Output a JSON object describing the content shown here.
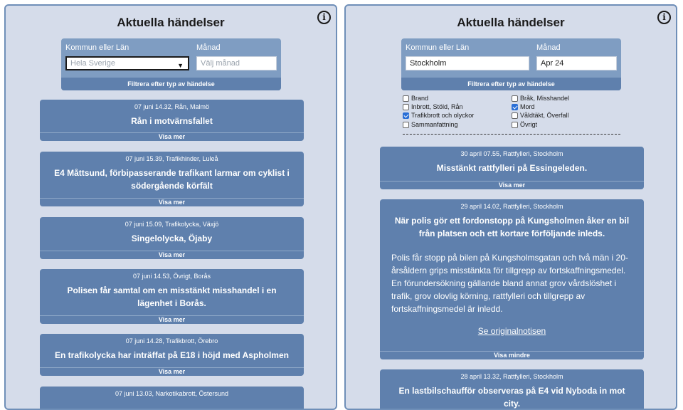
{
  "left": {
    "title": "Aktuella händelser",
    "filter": {
      "region_label": "Kommun eller Län",
      "region_placeholder": "Hela Sverige",
      "month_label": "Månad",
      "month_placeholder": "Välj månad",
      "type_button": "Filtrera efter typ av händelse"
    },
    "events": [
      {
        "meta": "07 juni 14.32, Rån, Malmö",
        "headline": "Rån i motvärnsfallet",
        "more": "Visa mer"
      },
      {
        "meta": "07 juni 15.39, Trafikhinder, Luleå",
        "headline": "E4 Måttsund, förbipasserande trafikant larmar om cyklist i södergående körfält",
        "more": "Visa mer"
      },
      {
        "meta": "07 juni 15.09, Trafikolycka, Växjö",
        "headline": "Singelolycka, Öjaby",
        "more": "Visa mer"
      },
      {
        "meta": "07 juni 14.53, Övrigt, Borås",
        "headline": "Polisen får samtal om en misstänkt misshandel i en lägenhet i Borås.",
        "more": "Visa mer"
      },
      {
        "meta": "07 juni 14.28, Trafikbrott, Örebro",
        "headline": "En trafikolycka har inträffat på E18 i höjd med Aspholmen",
        "more": "Visa mer"
      },
      {
        "meta": "07 juni 13.03, Narkotikabrott, Östersund",
        "headline": "",
        "more": ""
      }
    ]
  },
  "right": {
    "title": "Aktuella händelser",
    "filter": {
      "region_label": "Kommun eller Län",
      "region_value": "Stockholm",
      "month_label": "Månad",
      "month_value": "Apr 24",
      "type_button": "Filtrera efter typ av händelse"
    },
    "checkboxes": [
      {
        "label": "Brand",
        "checked": false
      },
      {
        "label": "Inbrott, Stöld, Rån",
        "checked": false
      },
      {
        "label": "Trafikbrott och olyckor",
        "checked": true
      },
      {
        "label": "Sammanfattning",
        "checked": false
      },
      {
        "label": "Bråk, Misshandel",
        "checked": false
      },
      {
        "label": "Mord",
        "checked": true
      },
      {
        "label": "Våldtäkt, Överfall",
        "checked": false
      },
      {
        "label": "Övrigt",
        "checked": false
      }
    ],
    "events": [
      {
        "meta": "30 april 07.55, Rattfylleri, Stockholm",
        "headline": "Misstänkt rattfylleri på Essingeleden.",
        "more": "Visa mer"
      },
      {
        "meta": "29 april 14.02, Rattfylleri, Stockholm",
        "headline": "När polis gör ett fordonstopp på Kungsholmen åker en bil från platsen och ett kortare förföljande inleds.",
        "body": "Polis får stopp på bilen på Kungsholmsgatan och två män i 20-årsåldern grips misstänkta för tillgrepp av fortskaffningsmedel. En förundersökning gällande bland annat grov vårdslöshet i trafik, grov olovlig körning, rattfylleri och tillgrepp av fortskaffningsmedel är inledd.",
        "link": "Se originalnotisen",
        "more": "Visa mindre"
      },
      {
        "meta": "28 april 13.32, Rattfylleri, Stockholm",
        "headline": "En lastbilschaufför observeras på E4 vid Nyboda in mot city.",
        "more": ""
      }
    ]
  },
  "colors": {
    "panel_bg": "#d5dcea",
    "panel_border": "#6f8fb8",
    "card_bg": "#5f80ad",
    "filter_bg": "#7f9dc2",
    "checkbox_on": "#2a6fd6"
  },
  "icons": {
    "info": "info-icon",
    "dropdown": "caret-down-icon"
  }
}
